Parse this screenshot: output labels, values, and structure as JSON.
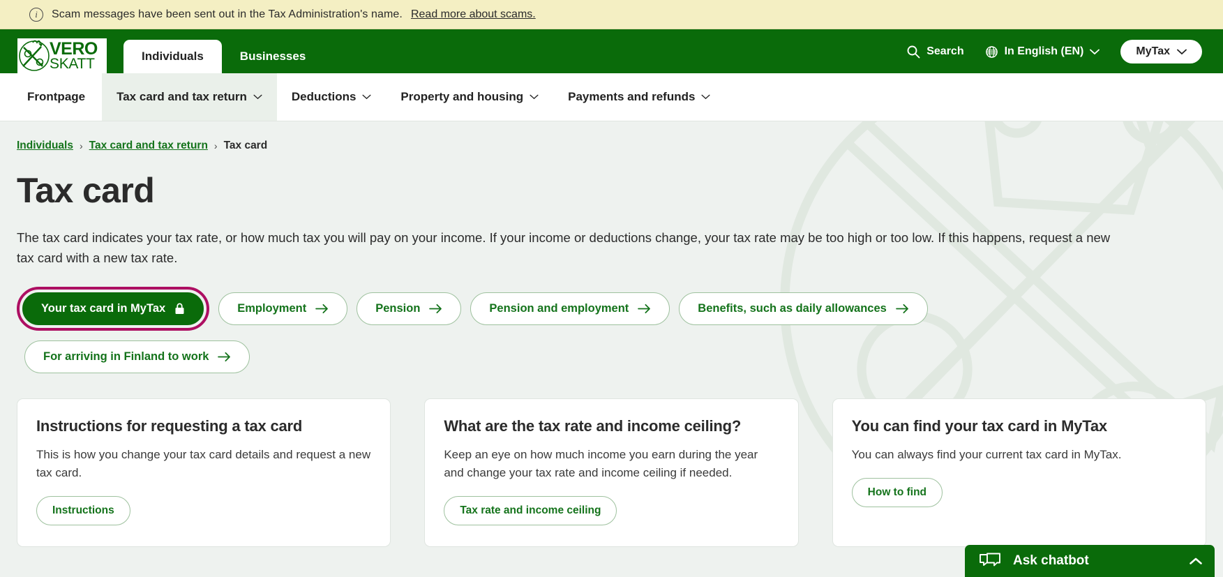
{
  "alert": {
    "icon": "info-icon",
    "text": "Scam messages have been sent out in the Tax Administration's name.",
    "link_text": "Read more about scams."
  },
  "header": {
    "logo": {
      "line1": "VERO",
      "line2": "SKATT"
    },
    "audience_tabs": [
      {
        "label": "Individuals",
        "active": true
      },
      {
        "label": "Businesses",
        "active": false
      }
    ],
    "search_label": "Search",
    "language_label": "In English (EN)",
    "mytax_label": "MyTax"
  },
  "nav": {
    "items": [
      {
        "label": "Frontpage",
        "has_chevron": false,
        "active": false
      },
      {
        "label": "Tax card and tax return",
        "has_chevron": true,
        "active": true
      },
      {
        "label": "Deductions",
        "has_chevron": true,
        "active": false
      },
      {
        "label": "Property and housing",
        "has_chevron": true,
        "active": false
      },
      {
        "label": "Payments and refunds",
        "has_chevron": true,
        "active": false
      }
    ]
  },
  "breadcrumb": {
    "items": [
      {
        "label": "Individuals",
        "is_link": true
      },
      {
        "label": "Tax card and tax return",
        "is_link": true
      },
      {
        "label": "Tax card",
        "is_link": false
      }
    ],
    "separator": "›"
  },
  "main": {
    "title": "Tax card",
    "intro": "The tax card indicates your tax rate, or how much tax you will pay on your income. If your income or deductions change, your tax rate may be too high or too low. If this happens, request a new tax card with a new tax rate.",
    "pills": [
      {
        "label": "Your tax card in MyTax",
        "icon": "lock-icon",
        "style": "primary",
        "focused": true
      },
      {
        "label": "Employment",
        "icon": "arrow-right-icon",
        "style": "outline",
        "focused": false
      },
      {
        "label": "Pension",
        "icon": "arrow-right-icon",
        "style": "outline",
        "focused": false
      },
      {
        "label": "Pension and employment",
        "icon": "arrow-right-icon",
        "style": "outline",
        "focused": false
      },
      {
        "label": "Benefits, such as daily allowances",
        "icon": "arrow-right-icon",
        "style": "outline",
        "focused": false
      },
      {
        "label": "For arriving in Finland to work",
        "icon": "arrow-right-icon",
        "style": "outline",
        "focused": false
      }
    ],
    "cards": [
      {
        "title": "Instructions for requesting a tax card",
        "text": "This is how you change your tax card details and request a new tax card.",
        "button": "Instructions"
      },
      {
        "title": "What are the tax rate and income ceiling?",
        "text": "Keep an eye on how much income you earn during the year and change your tax rate and income ceiling if needed.",
        "button": "Tax rate and income ceiling"
      },
      {
        "title": "You can find your tax card in MyTax",
        "text": "You can always find your current tax card in MyTax.",
        "button": "How to find"
      }
    ]
  },
  "chatbot": {
    "label": "Ask chatbot",
    "icon": "chat-bubbles-icon",
    "toggle_icon": "chevron-up-icon"
  },
  "colors": {
    "brand_green": "#0a6b0a",
    "link_green": "#14731b",
    "focus_magenta": "#ad0f62",
    "alert_bg": "#f4efc3",
    "page_bg": "#eef2ef"
  }
}
